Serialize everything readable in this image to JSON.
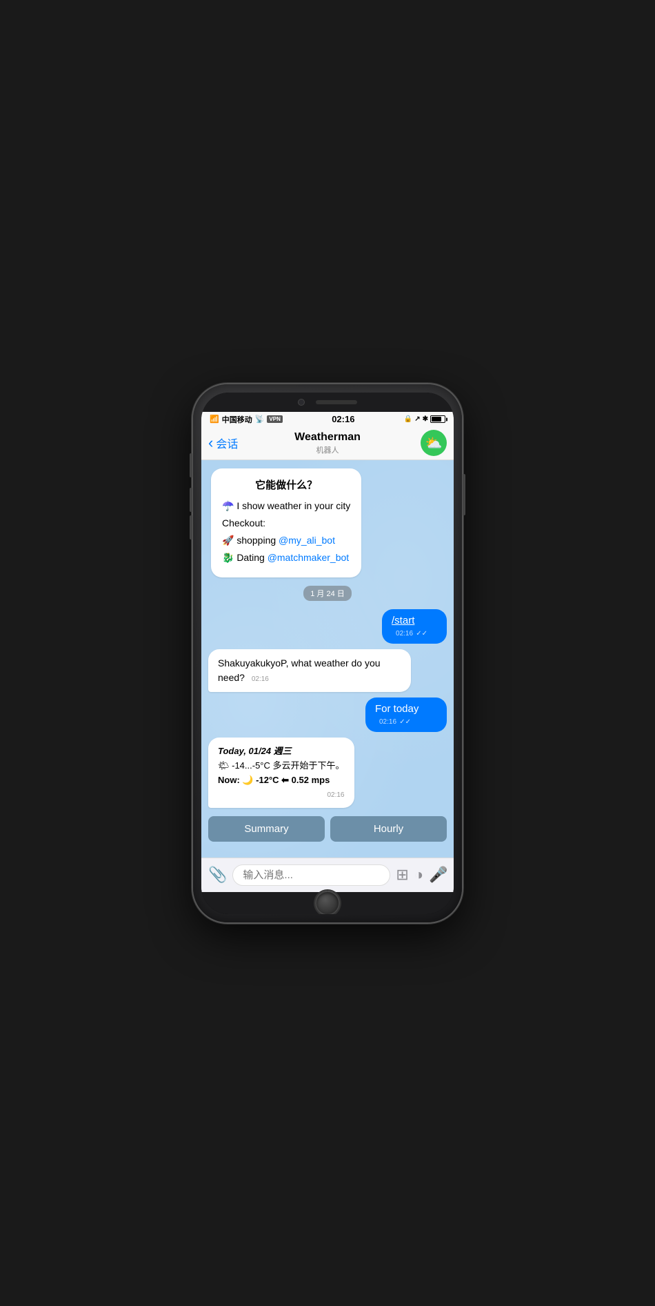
{
  "phone": {
    "status_bar": {
      "carrier": "中国移动",
      "wifi": "wifi",
      "vpn": "VPN",
      "time": "02:16",
      "lock_icon": "🔒",
      "location_icon": "↗",
      "bluetooth": "✱"
    },
    "nav": {
      "back_label": "会话",
      "title": "Weatherman",
      "subtitle": "机器人"
    },
    "chat": {
      "welcome_title": "它能做什么？",
      "welcome_line1": "☂️ I show weather in your city",
      "welcome_checkout": "Checkout:",
      "welcome_shopping": "🚀 shopping ",
      "welcome_shopping_link": "@my_ali_bot",
      "welcome_dating": "🐉 Dating ",
      "welcome_dating_link": "@matchmaker_bot",
      "date_separator": "1 月 24 日",
      "user_msg1": "/start",
      "user_msg1_time": "02:16",
      "bot_reply1": "ShakuyakukyoP, what weather do you need?",
      "bot_reply1_time": "02:16",
      "user_msg2": "For today",
      "user_msg2_time": "02:16",
      "weather_date": "Today, 01/24 週三",
      "weather_temp": "🌤 -14...-5°C 多云开始于下午。",
      "weather_now": "Now: 🌙 -12°C ⬅ 0.52 mps",
      "weather_time": "02:16",
      "btn_summary": "Summary",
      "btn_hourly": "Hourly"
    },
    "input": {
      "placeholder": "输入消息..."
    }
  }
}
